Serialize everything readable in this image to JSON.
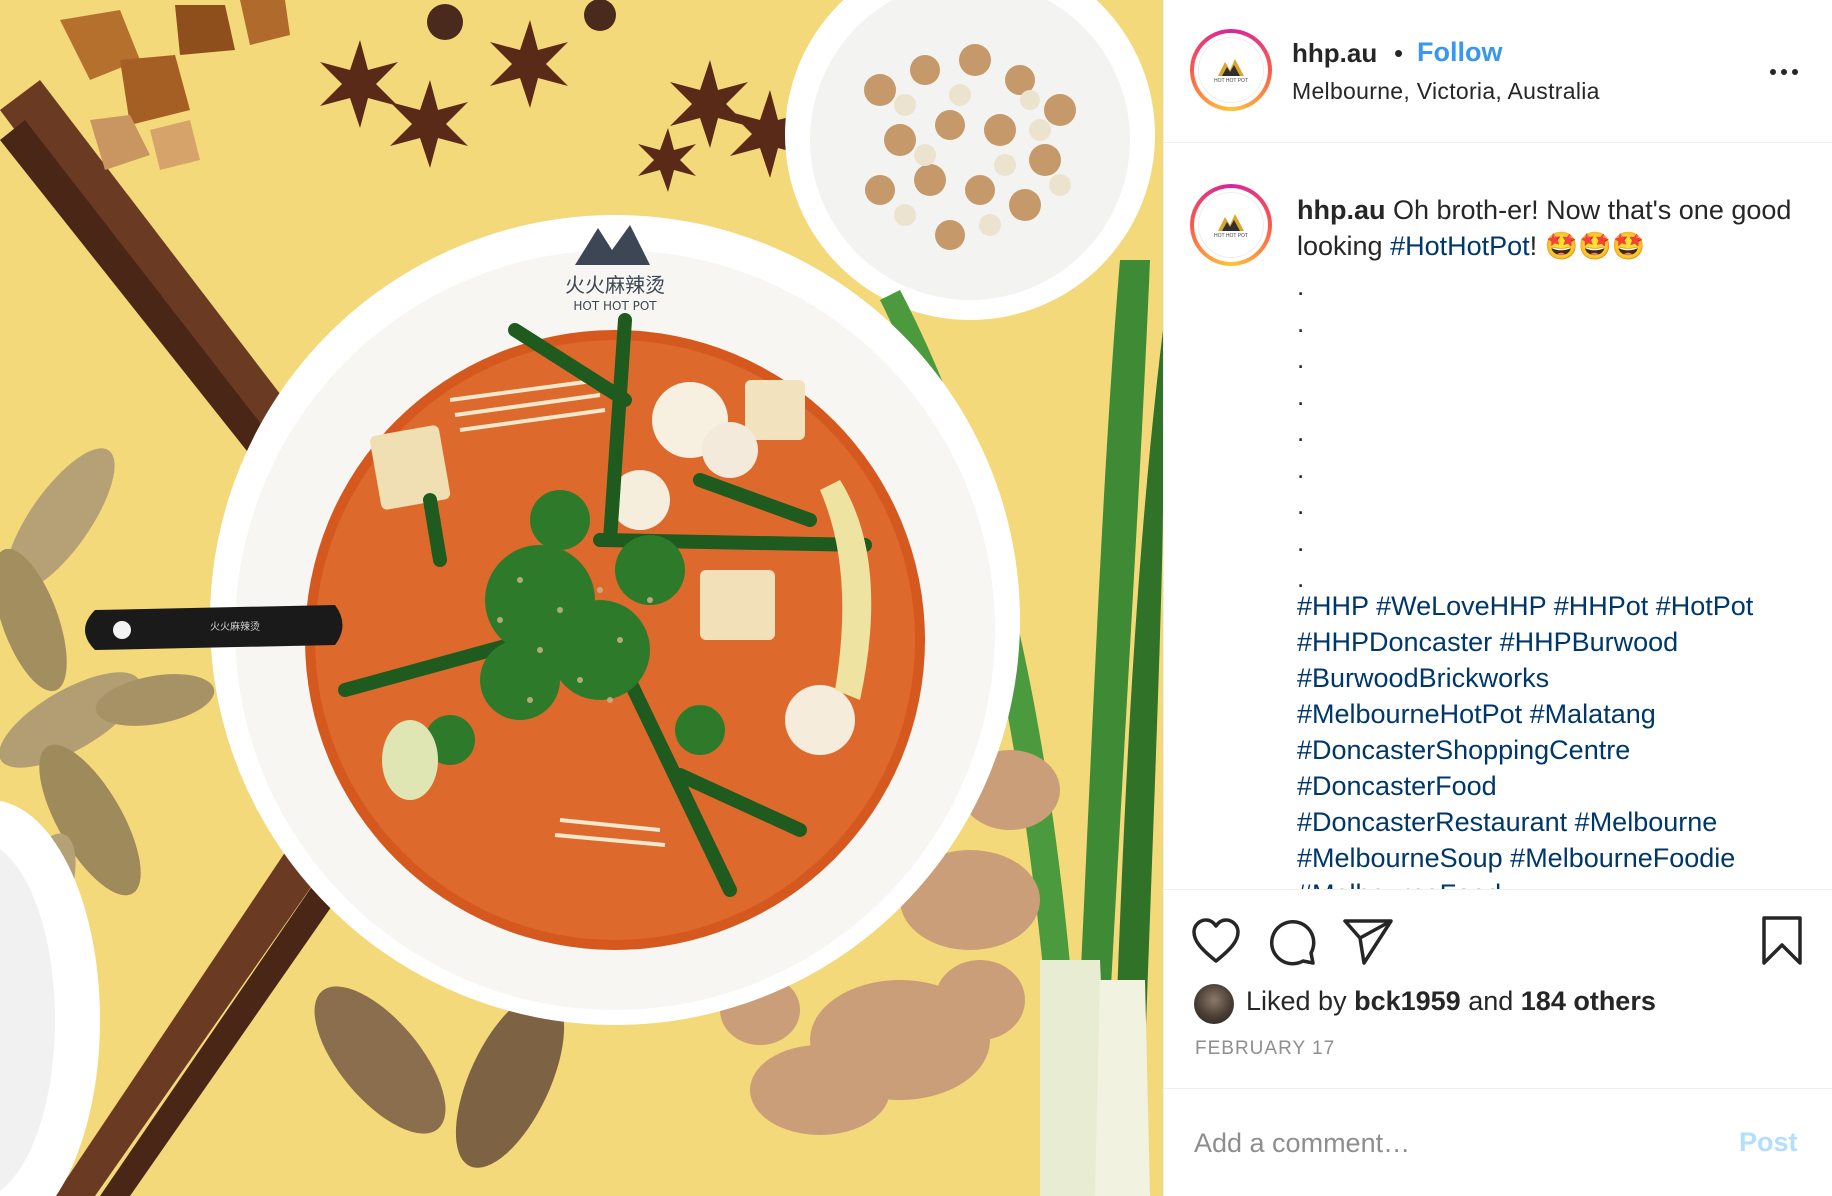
{
  "header": {
    "username": "hhp.au",
    "separator": "•",
    "follow_label": "Follow",
    "location": "Melbourne, Victoria, Australia",
    "more_icon": "more-horizontal-icon"
  },
  "avatar": {
    "logo_text": "HOT HOT POT"
  },
  "caption": {
    "username": "hhp.au",
    "text": "Oh broth-er! Now that's one good looking",
    "hashtag": "#HotHotPot",
    "suffix": "! 🤩🤩🤩",
    "dots": [
      ".",
      ".",
      ".",
      ".",
      ".",
      ".",
      ".",
      ".",
      "."
    ],
    "tags": [
      "#HHP",
      "#WeLoveHHP",
      "#HHPot",
      "#HotPot",
      "#HHPDoncaster",
      "#HHPBurwood",
      "#BurwoodBrickworks",
      "#MelbourneHotPot",
      "#Malatang",
      "#DoncasterShoppingCentre",
      "#DoncasterFood",
      "#DoncasterRestaurant",
      "#Melbourne",
      "#MelbourneSoup",
      "#MelbourneFoodie",
      "#MelbourneFood"
    ]
  },
  "actions": {
    "like_icon": "heart-icon",
    "comment_icon": "comment-icon",
    "share_icon": "paper-plane-icon",
    "save_icon": "bookmark-icon"
  },
  "likes": {
    "prefix": "Liked by",
    "user": "bck1959",
    "and": "and",
    "others": "184 others"
  },
  "date": "FEBRUARY 17",
  "comment_box": {
    "placeholder": "Add a comment…",
    "post_label": "Post"
  },
  "photo": {
    "bowl_brand_cn": "火火麻辣烫",
    "bowl_brand_en": "HOT HOT POT",
    "spoon_brand": "火火麻辣烫"
  },
  "colors": {
    "follow": "#3897f0",
    "hashtag": "#00376b",
    "post_disabled": "#b2dffc",
    "muted": "#8e8e8e",
    "photo_background": "#f4d97a"
  }
}
